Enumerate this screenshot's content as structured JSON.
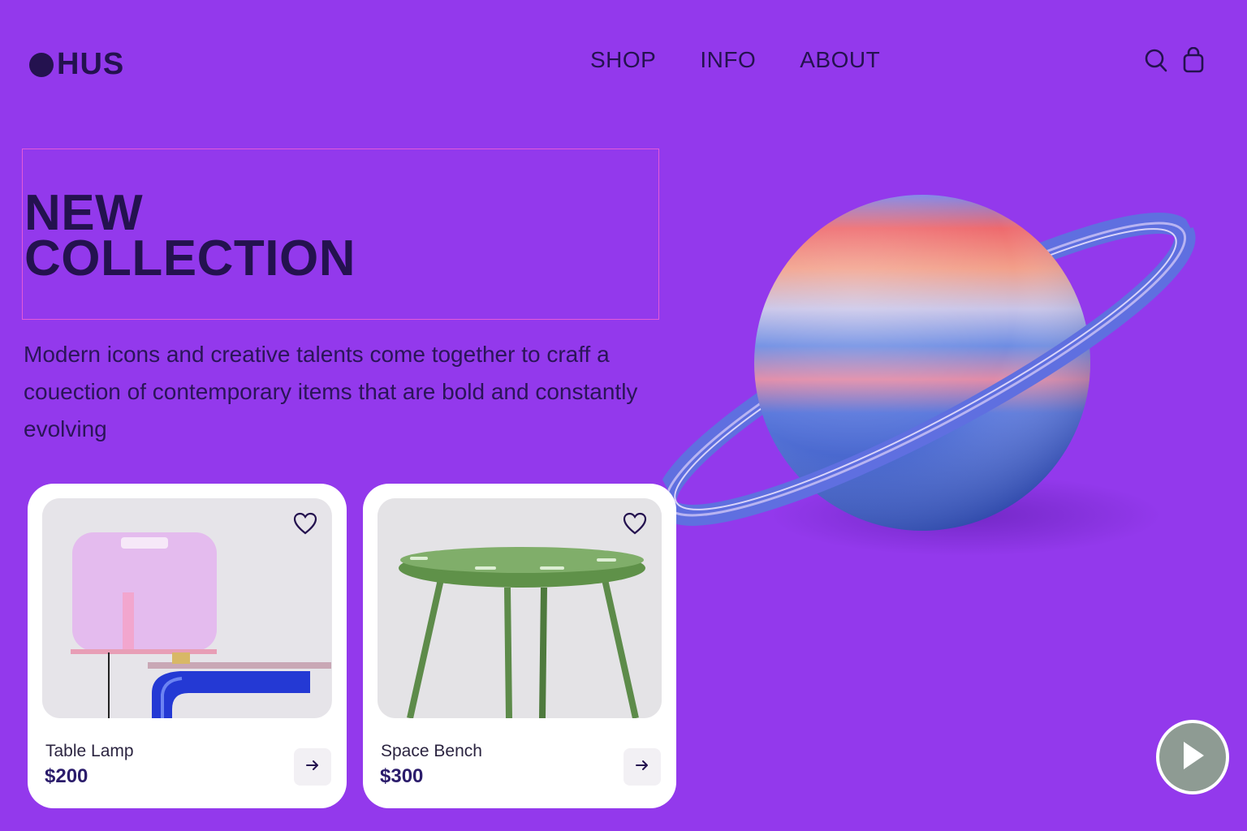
{
  "header": {
    "logo_text": "HUS",
    "nav": [
      {
        "label": "SHOP"
      },
      {
        "label": "INFO"
      },
      {
        "label": "ABOUT"
      }
    ],
    "icons": [
      "search-icon",
      "shopping-bag-icon"
    ]
  },
  "hero": {
    "title_line1": "NEW",
    "title_line2": "COLLECTION",
    "subtitle": "Modern icons and creative talents come together to craff a couection of contemporary items that are bold and constantly evolving"
  },
  "products": [
    {
      "name": "Table Lamp",
      "price": "$200"
    },
    {
      "name": "Space Bench",
      "price": "$300"
    }
  ],
  "colors": {
    "background": "#9339EC",
    "text": "#24124F",
    "card": "#FFFFFF",
    "highlight_border": "#E45AD8",
    "play_button": "#8E9B93"
  }
}
